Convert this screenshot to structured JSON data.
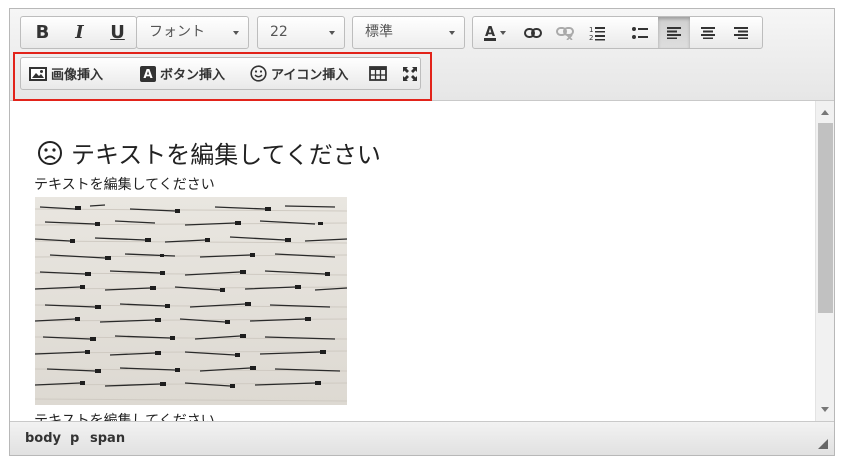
{
  "toolbar": {
    "format_buttons": {
      "bold": "B",
      "italic": "I",
      "underline": "U"
    },
    "font_select": {
      "value": "フォント"
    },
    "size_select": {
      "value": "22"
    },
    "style_select": {
      "value": "標準"
    },
    "icons": [
      "font-color-icon",
      "link-icon",
      "unlink-icon",
      "ordered-list-icon",
      "unordered-list-icon",
      "align-left-icon",
      "align-center-icon",
      "align-right-icon"
    ],
    "insert": {
      "image_label": "画像挿入",
      "button_label": "ボタン挿入",
      "button_badge": "A",
      "icon_label": "アイコン挿入"
    }
  },
  "content": {
    "heading": "テキストを編集してください",
    "paragraph": "テキストを編集してください",
    "paragraph_2": "テキストを編集してください"
  },
  "statusbar": {
    "path": [
      "body",
      "p",
      "span"
    ]
  },
  "colors": {
    "highlight": "#e2231a",
    "accent": "#333333"
  }
}
